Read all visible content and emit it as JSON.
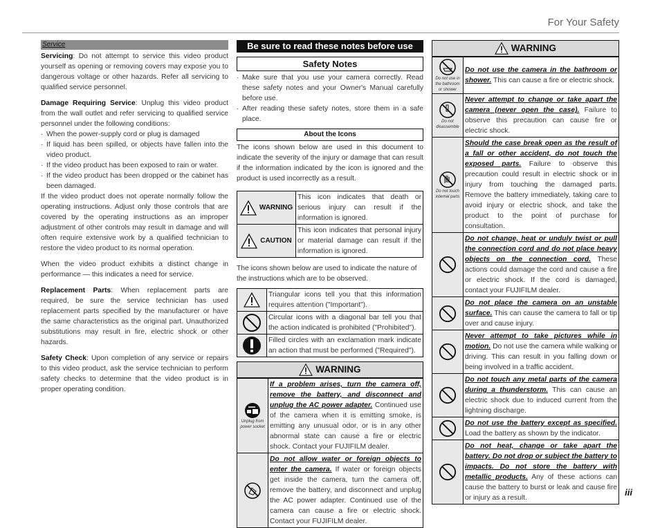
{
  "header": {
    "title": "For Your Safety"
  },
  "page_number": "iii",
  "col1": {
    "section_label": "Service",
    "paragraphs": {
      "servicing_lead": "Servicing",
      "servicing": ": Do not attempt to service this video product yourself as opening or removing covers may expose you to dangerous voltage or other hazards.  Refer all servicing to qualified service personnel.",
      "damage_lead": "Damage Requiring Service",
      "damage": ": Unplug this video product from the wall outlet and refer servicing to qualified service personnel under the following conditions:",
      "damage_items": [
        "When the power-supply cord or plug is damaged",
        "If liquid has been spilled, or objects have fallen into the video product.",
        "If the video product has been exposed to rain or water.",
        "If the video product has been dropped or the cabinet has been damaged."
      ],
      "operate": "If the video product does not operate normally follow the operating instructions.  Adjust only those controls that are covered by the operating instructions as an improper adjustment of other controls may result in damage and will often require extensive work by a qualified technician to restore the video product to its normal operation.",
      "performance": "When the video product exhibits a distinct change in performance — this indicates a need for service.",
      "replacement_lead": "Replacement Parts",
      "replacement": ": When replacement parts are required, be sure the service technician has used replacement parts specified by the manufacturer or have the same characteristics as the original part.  Unauthorized substitutions may result in fire, electric shock or other hazards.",
      "check_lead": "Safety Check",
      "check": ": Upon completion of any service or repairs to this video product, ask the service technician to perform safety checks to determine that the video product is in proper operating condition."
    }
  },
  "col2": {
    "banner": "Be sure to read these notes before use",
    "title": "Safety Notes",
    "bullets": [
      "Make sure that you use your camera correctly.  Read these safety notes and your Owner's Manual carefully before use.",
      "After reading these safety notes, store them in a safe place."
    ],
    "about_title": "About the Icons",
    "about_text": "The icons shown below are used in this document to indicate the severity of the injury or damage that can result if the information indicated by the icon is ignored and the product is used incorrectly as a result.",
    "severity": [
      {
        "icon": "warning-triangle-icon",
        "label": "WARNING",
        "text": "This icon indicates that death or serious injury can result if the information is ignored."
      },
      {
        "icon": "caution-triangle-icon",
        "label": "CAUTION",
        "text": "This icon indicates that personal injury or material damage can result if the information is ignored."
      }
    ],
    "nature_text": "The icons shown below are used to indicate the nature of the instructions which are to be observed.",
    "nature": [
      {
        "icon": "triangle-icon",
        "text": "Triangular icons tell you that this information requires attention (\"Important\")."
      },
      {
        "icon": "prohibited-icon",
        "text": "Circular icons with a diagonal bar tell you that the action indicated is prohibited (\"Prohibited\")."
      },
      {
        "icon": "required-icon",
        "text": "Filled circles with an exclamation mark indicate an action that must be performed (\"Required\")."
      }
    ],
    "warning_title": "WARNING",
    "warnings": [
      {
        "icon": "unplug-icon",
        "caption": "Unplug from power socket",
        "lead": "If a problem arises, turn the camera off, remove the battery, and disconnect and unplug the AC power adapter.",
        "text": " Continued use of the camera when it is emitting smoke, is emitting any unusual odor, or is in any other abnormal state can cause a fire or electric shock.  Contact your FUJIFILM dealer."
      },
      {
        "icon": "no-water-icon",
        "caption": "",
        "lead": "Do not allow water or foreign objects to enter the camera.",
        "text": " If water or foreign objects get inside the camera, turn the camera off, remove the battery, and disconnect and unplug the AC power adapter.  Continued use of the camera can cause a fire or electric shock.  Contact your FUJIFILM dealer."
      }
    ]
  },
  "col3": {
    "warning_title": "WARNING",
    "warnings": [
      {
        "icon": "no-bathroom-icon",
        "caption": "Do not use in the bathroom or shower",
        "lead": "Do not use the camera in the bathroom or shower.",
        "text": " This can cause a fire or electric shock."
      },
      {
        "icon": "no-disassemble-icon",
        "caption": "Do not disassemble",
        "lead": "Never attempt to change or take apart the camera (never open the case).",
        "text": " Failure to observe this precaution can cause fire or electric shock."
      },
      {
        "icon": "no-touch-icon",
        "caption": "Do not touch internal parts",
        "lead": "Should the case break open as the result of a fall or other accident, do not touch the exposed parts.",
        "text": " Failure to observe this precaution could result in electric shock or in injury from touching the damaged parts.  Remove the battery immediately, taking care to avoid injury or electric shock, and take the product to the point of purchase for consultation."
      },
      {
        "icon": "prohibited-icon",
        "caption": "",
        "lead": "Do not change, heat or unduly twist or pull the connection cord and do not place heavy objects on the connection cord.",
        "text": " These actions could damage the cord and cause a fire or electric shock.  If the cord is damaged, contact your FUJIFILM dealer."
      },
      {
        "icon": "prohibited-icon",
        "caption": "",
        "lead": "Do not place the camera on an unstable surface.",
        "text": " This can cause the camera to fall or tip over and cause injury."
      },
      {
        "icon": "prohibited-icon",
        "caption": "",
        "lead": "Never attempt to take pictures while in motion.",
        "text": " Do not use the camera while walking or driving.  This can result in you falling down or being involved in a traffic accident."
      },
      {
        "icon": "prohibited-icon",
        "caption": "",
        "lead": "Do not touch any metal parts of the camera during a thunderstorm.",
        "text": " This can cause an electric shock due to induced current from the lightning discharge."
      },
      {
        "icon": "prohibited-icon",
        "caption": "",
        "lead": "Do not use the battery except as specified.",
        "text": " Load the battery as shown by the indicator."
      },
      {
        "icon": "prohibited-icon",
        "caption": "",
        "lead": "Do not heat, change or take apart the battery.  Do not drop or subject the battery to impacts.  Do not store the battery with metallic products.",
        "text": " Any of these actions can cause the battery to burst or leak and cause fire or injury as a result."
      }
    ]
  }
}
